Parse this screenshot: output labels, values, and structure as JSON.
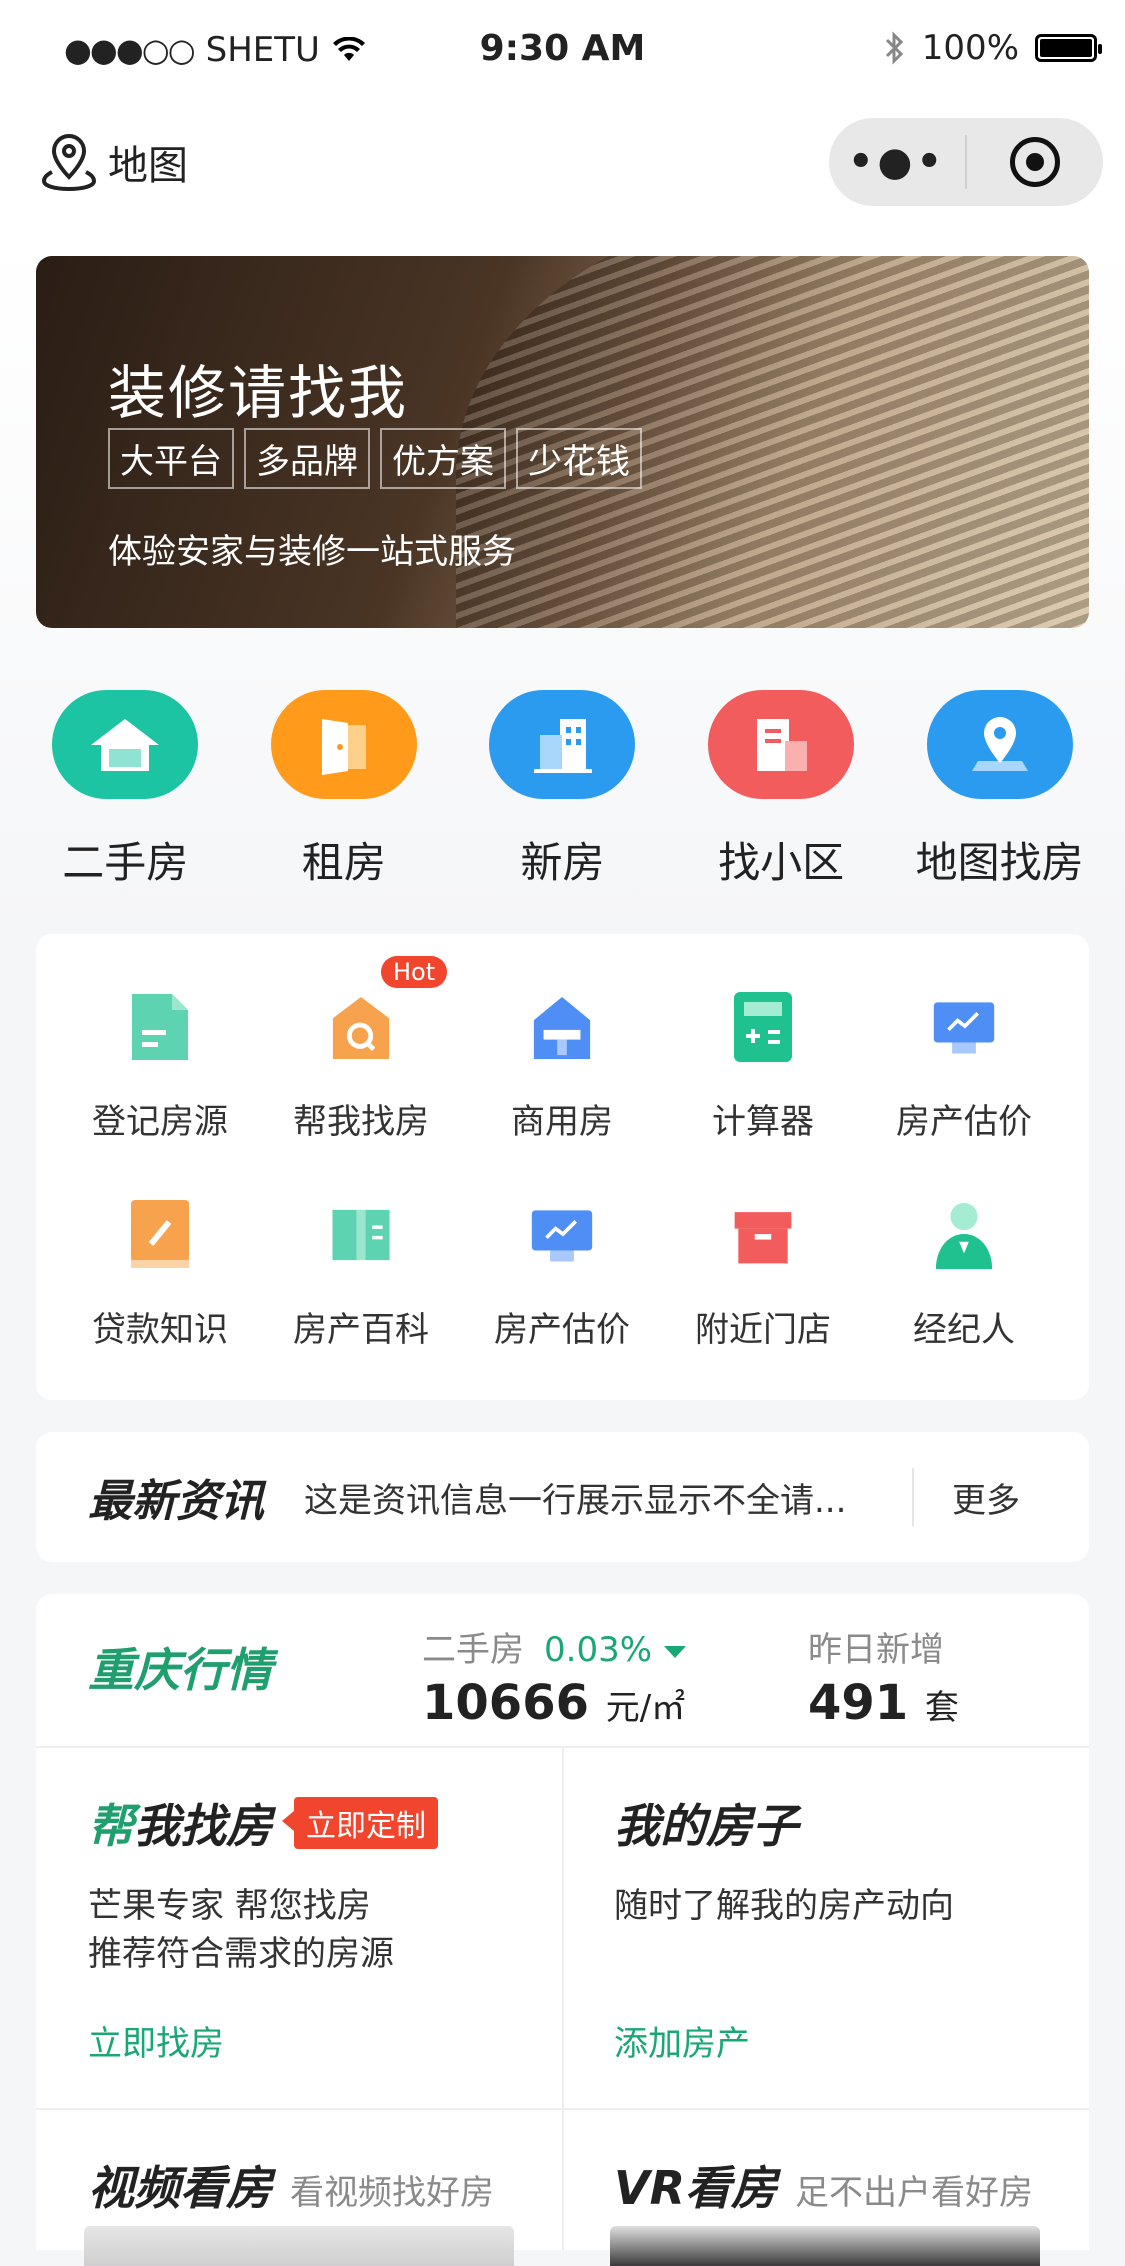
{
  "status": {
    "carrier": "SHETU",
    "time": "9:30 AM",
    "battery": "100%"
  },
  "nav": {
    "map_label": "地图"
  },
  "banner": {
    "title": "装修请找我",
    "tags": [
      "大平台",
      "多品牌",
      "优方案",
      "少花钱"
    ],
    "subtitle": "体验安家与装修一站式服务"
  },
  "main_icons": [
    {
      "label": "二手房",
      "color": "#1cc4a4"
    },
    {
      "label": "租房",
      "color": "#ff9a1a"
    },
    {
      "label": "新房",
      "color": "#2b9bf0"
    },
    {
      "label": "找小区",
      "color": "#f35c5c"
    },
    {
      "label": "地图找房",
      "color": "#2b9bf0"
    }
  ],
  "grid": {
    "hot_badge": "Hot",
    "items": [
      {
        "label": "登记房源"
      },
      {
        "label": "帮我找房"
      },
      {
        "label": "商用房"
      },
      {
        "label": "计算器"
      },
      {
        "label": "房产估价"
      },
      {
        "label": "贷款知识"
      },
      {
        "label": "房产百科"
      },
      {
        "label": "房产估价"
      },
      {
        "label": "附近门店"
      },
      {
        "label": "经纪人"
      }
    ]
  },
  "news": {
    "heading": "最新资讯",
    "text": "这是资讯信息一行展示显示不全请...",
    "more": "更多"
  },
  "market": {
    "title": "重庆行情",
    "secondhand_label": "二手房",
    "secondhand_change": "0.03%",
    "price": "10666",
    "price_unit": "元/㎡",
    "new_label": "昨日新增",
    "new_count": "491",
    "new_unit": "套"
  },
  "help": {
    "title_first": "帮",
    "title_rest": "我找房",
    "badge": "立即定制",
    "line1": "芒果专家 帮您找房",
    "line2": "推荐符合需求的房源",
    "action": "立即找房"
  },
  "myhouse": {
    "title": "我的房子",
    "line1": "随时了解我的房产动向",
    "action": "添加房产"
  },
  "video": {
    "title": "视频看房",
    "subtitle": "看视频找好房"
  },
  "vr": {
    "title": "VR看房",
    "subtitle": "足不出户看好房"
  }
}
